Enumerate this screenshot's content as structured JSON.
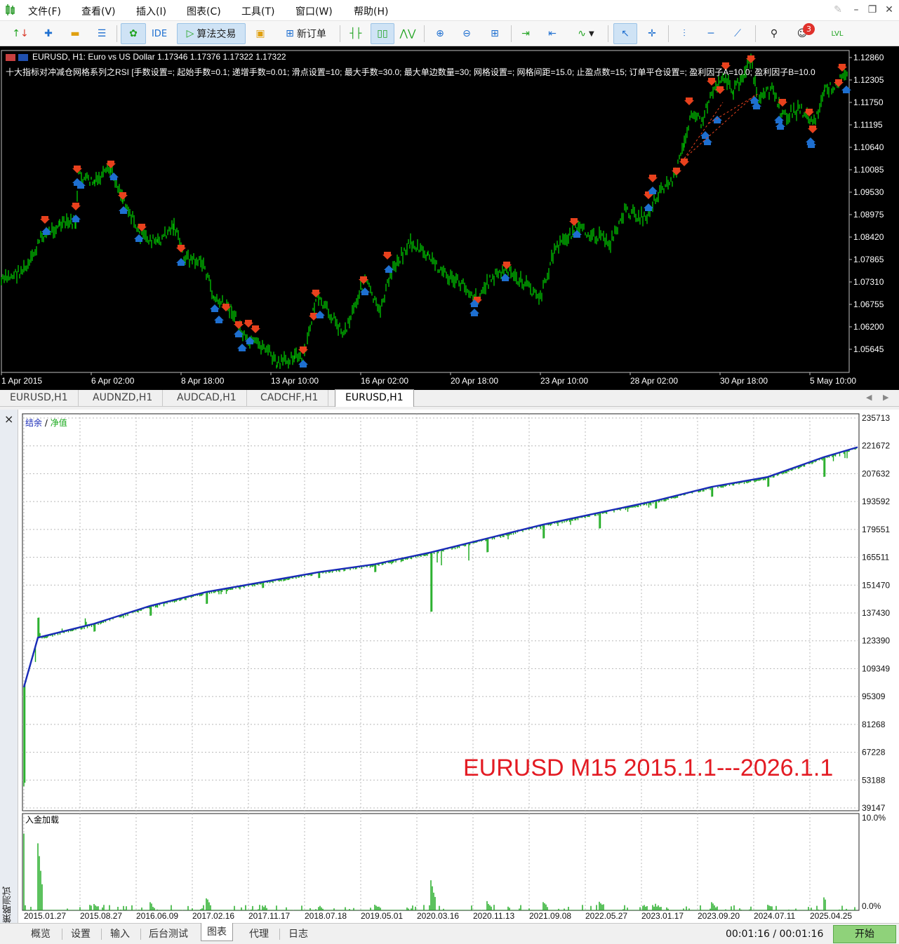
{
  "menu": {
    "items": [
      "文件(F)",
      "查看(V)",
      "插入(I)",
      "图表(C)",
      "工具(T)",
      "窗口(W)",
      "帮助(H)"
    ]
  },
  "toolbar": {
    "ide_label": "IDE",
    "algo_label": "算法交易",
    "new_order_label": "新订单",
    "alerts_count": "3",
    "lvl_label": "LVL"
  },
  "chart": {
    "symbol_header": "EURUSD, H1:  Euro vs US Dollar  1.17346 1.17376 1.17322 1.17322",
    "ea_info": "十大指标对冲减仓网格系列之RSI [手数设置=; 起始手数=0.1; 递增手数=0.01; 滑点设置=10; 最大手数=30.0; 最大单边数量=30; 网格设置=; 网格间距=15.0; 止盈点数=15; 订单平仓设置=; 盈利因子A=10.0; 盈利因子B=10.0",
    "price_ticks": [
      "1.12860",
      "1.12305",
      "1.11750",
      "1.11195",
      "1.10640",
      "1.10085",
      "1.09530",
      "1.08975",
      "1.08420",
      "1.07865",
      "1.07310",
      "1.06755",
      "1.06200",
      "1.05645"
    ],
    "time_ticks": [
      "1 Apr 2015",
      "6 Apr 02:00",
      "8 Apr 18:00",
      "13 Apr 10:00",
      "16 Apr 02:00",
      "20 Apr 18:00",
      "23 Apr 10:00",
      "28 Apr 02:00",
      "30 Apr 18:00",
      "5 May 10:00"
    ],
    "candle_color": "#00c800",
    "sell_arrow_color": "#e8411d",
    "buy_arrow_color": "#1e6fd0"
  },
  "chart_tabs": [
    "EURUSD,H1",
    "AUDNZD,H1",
    "AUDCAD,H1",
    "CADCHF,H1",
    "EURUSD,H1"
  ],
  "tester": {
    "close_icon": "×",
    "side_label": "策略测试",
    "balance_label": "结余",
    "equity_label": "净值",
    "legend_sep": " / ",
    "deposit_label": "入金加载",
    "annotation": "EURUSD M15 2015.1.1---2026.1.1",
    "y_ticks": [
      "235713",
      "221672",
      "207632",
      "193592",
      "179551",
      "165511",
      "151470",
      "137430",
      "123390",
      "109349",
      "95309",
      "81268",
      "67228",
      "53188",
      "39147"
    ],
    "x_ticks": [
      "2015.01.27",
      "2015.08.27",
      "2016.06.09",
      "2017.02.16",
      "2017.11.17",
      "2018.07.18",
      "2019.05.01",
      "2020.03.16",
      "2020.11.13",
      "2021.09.08",
      "2022.05.27",
      "2023.01.17",
      "2023.09.20",
      "2024.07.11",
      "2025.04.25"
    ],
    "load_ticks": [
      "10.0%",
      "0.0%"
    ],
    "balance_color": "#1a2bb8",
    "equity_color": "#17a81a"
  },
  "chart_data": {
    "type": "line",
    "title": "",
    "series": [
      {
        "name": "结余",
        "x": [
          "2015.01.01",
          "2015.01.27",
          "2015.08.27",
          "2016.06.09",
          "2017.02.16",
          "2017.11.17",
          "2018.07.18",
          "2019.05.01",
          "2020.03.16",
          "2020.11.13",
          "2021.09.08",
          "2022.05.27",
          "2023.01.17",
          "2023.09.20",
          "2024.07.11",
          "2025.04.25",
          "2026.01.01"
        ],
        "values": [
          100000,
          125000,
          132000,
          141000,
          148000,
          153000,
          158000,
          162000,
          168000,
          175000,
          182000,
          188000,
          194000,
          201000,
          206000,
          216000,
          221000
        ]
      },
      {
        "name": "净值",
        "drawdown_min_values": [
          50000,
          135000,
          128000,
          136000,
          142000,
          150000,
          155000,
          158000,
          138000,
          168000,
          175000,
          180000,
          190000,
          196000,
          201000,
          206000,
          218000
        ]
      }
    ],
    "deposit_load_percent": [
      8.0,
      7.0,
      0.5,
      0.6,
      1.2,
      0.4,
      0.3,
      0.4,
      3.0,
      0.8,
      0.6,
      0.9,
      0.5,
      0.6,
      0.4,
      1.3,
      0.3
    ],
    "ylim": [
      39147,
      235713
    ],
    "load_ylim": [
      0,
      10
    ]
  },
  "bottom_tabs": [
    "概览",
    "设置",
    "输入",
    "后台测试",
    "图表",
    "代理",
    "日志"
  ],
  "timer": "00:01:16 / 00:01:16",
  "start_label": "开始"
}
